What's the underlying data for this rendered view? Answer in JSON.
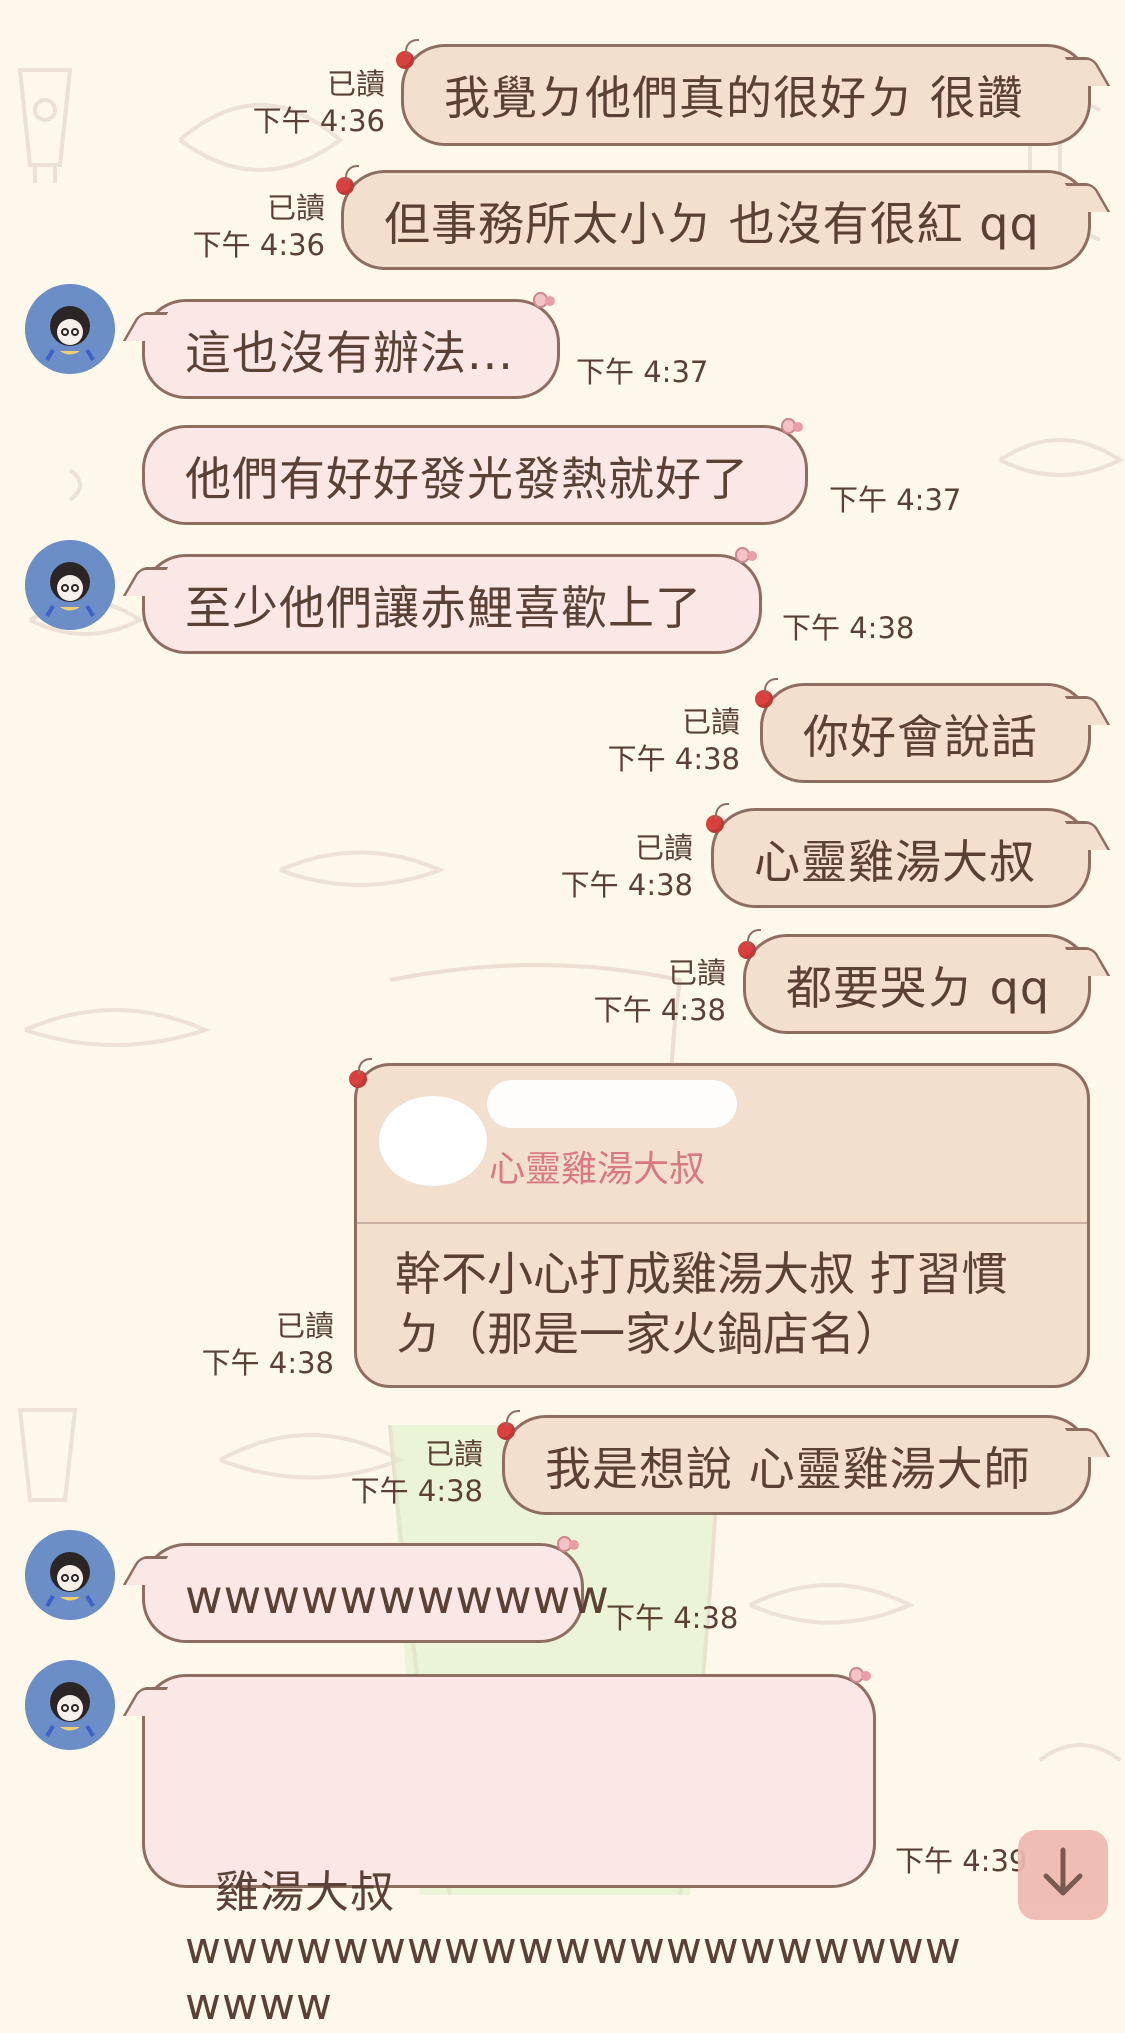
{
  "chat": {
    "messages": [
      {
        "id": "m1",
        "side": "mine",
        "text": "我覺ㄉ他們真的很好ㄉ 很讚",
        "read": "已讀",
        "time": "下午 4:36"
      },
      {
        "id": "m2",
        "side": "mine",
        "text": "但事務所太小ㄉ 也沒有很紅 qq",
        "read": "已讀",
        "time": "下午 4:36"
      },
      {
        "id": "m3",
        "side": "theirs",
        "text": "這也沒有辦法...",
        "time": "下午 4:37"
      },
      {
        "id": "m4",
        "side": "theirs",
        "text": "他們有好好發光發熱就好了",
        "time": "下午 4:37"
      },
      {
        "id": "m5",
        "side": "theirs",
        "text": "至少他們讓赤鯉喜歡上了",
        "time": "下午 4:38"
      },
      {
        "id": "m6",
        "side": "mine",
        "text": "你好會說話",
        "read": "已讀",
        "time": "下午 4:38"
      },
      {
        "id": "m7",
        "side": "mine",
        "text": "心靈雞湯大叔",
        "read": "已讀",
        "time": "下午 4:38"
      },
      {
        "id": "m8",
        "side": "mine",
        "text": "都要哭ㄉ qq",
        "read": "已讀",
        "time": "下午 4:38"
      },
      {
        "id": "m9",
        "side": "mine",
        "reply_quote": "心靈雞湯大叔",
        "text": "幹不小心打成雞湯大叔 打習慣\nㄉ（那是一家火鍋店名）",
        "read": "已讀",
        "time": "下午 4:38"
      },
      {
        "id": "m10",
        "side": "mine",
        "text": "我是想說 心靈雞湯大師",
        "read": "已讀",
        "time": "下午 4:38"
      },
      {
        "id": "m11",
        "side": "theirs",
        "text": "wwwwwwwwwww",
        "time": "下午 4:38"
      },
      {
        "id": "m12",
        "side": "theirs",
        "text": "雞湯大叔\nwwwwwwwwwwwwwwwwwwwww\nwwww",
        "time": "下午 4:39"
      }
    ]
  },
  "icons": {
    "scroll_down": "arrow-down-icon",
    "avatar": "avatar-icon",
    "cherry": "cherry-icon",
    "bow": "bow-icon"
  },
  "colors": {
    "background": "#fdf8ea",
    "mine_bubble": "#f3dfce",
    "their_bubble": "#fbe7e6",
    "outline": "#8f6e62",
    "text": "#5b4036",
    "quote_name": "#d87a7f",
    "scroll_button": "#efb8b0"
  }
}
